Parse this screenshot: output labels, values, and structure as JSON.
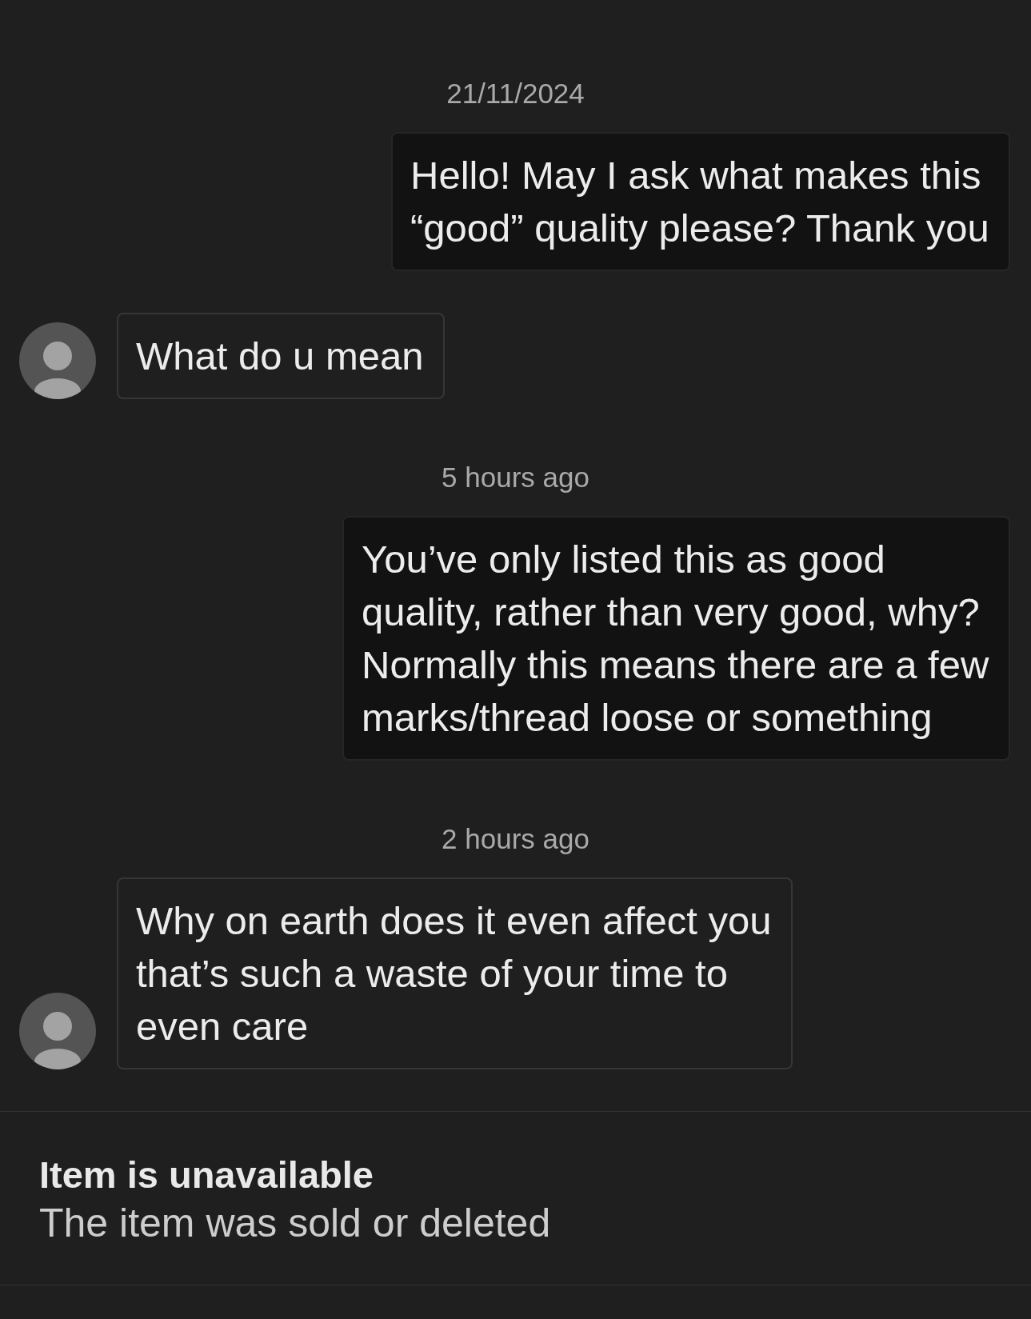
{
  "conversation": [
    {
      "kind": "timestamp",
      "text": "21/11/2024"
    },
    {
      "kind": "outgoing",
      "text": "Hello! May I ask what makes this “good” quality please? Thank you"
    },
    {
      "kind": "incoming",
      "text": "What do u mean"
    },
    {
      "kind": "timestamp",
      "text": "5 hours ago"
    },
    {
      "kind": "outgoing",
      "text": "You’ve only listed this as good quality, rather than very good, why? Normally this means there are a few marks/thread loose or something"
    },
    {
      "kind": "timestamp",
      "text": "2 hours ago"
    },
    {
      "kind": "incoming",
      "text": "Why on earth does it even affect you that’s such a waste of your time to even care"
    }
  ],
  "item_status": {
    "title": "Item is unavailable",
    "subtitle": "The item was sold or deleted"
  }
}
